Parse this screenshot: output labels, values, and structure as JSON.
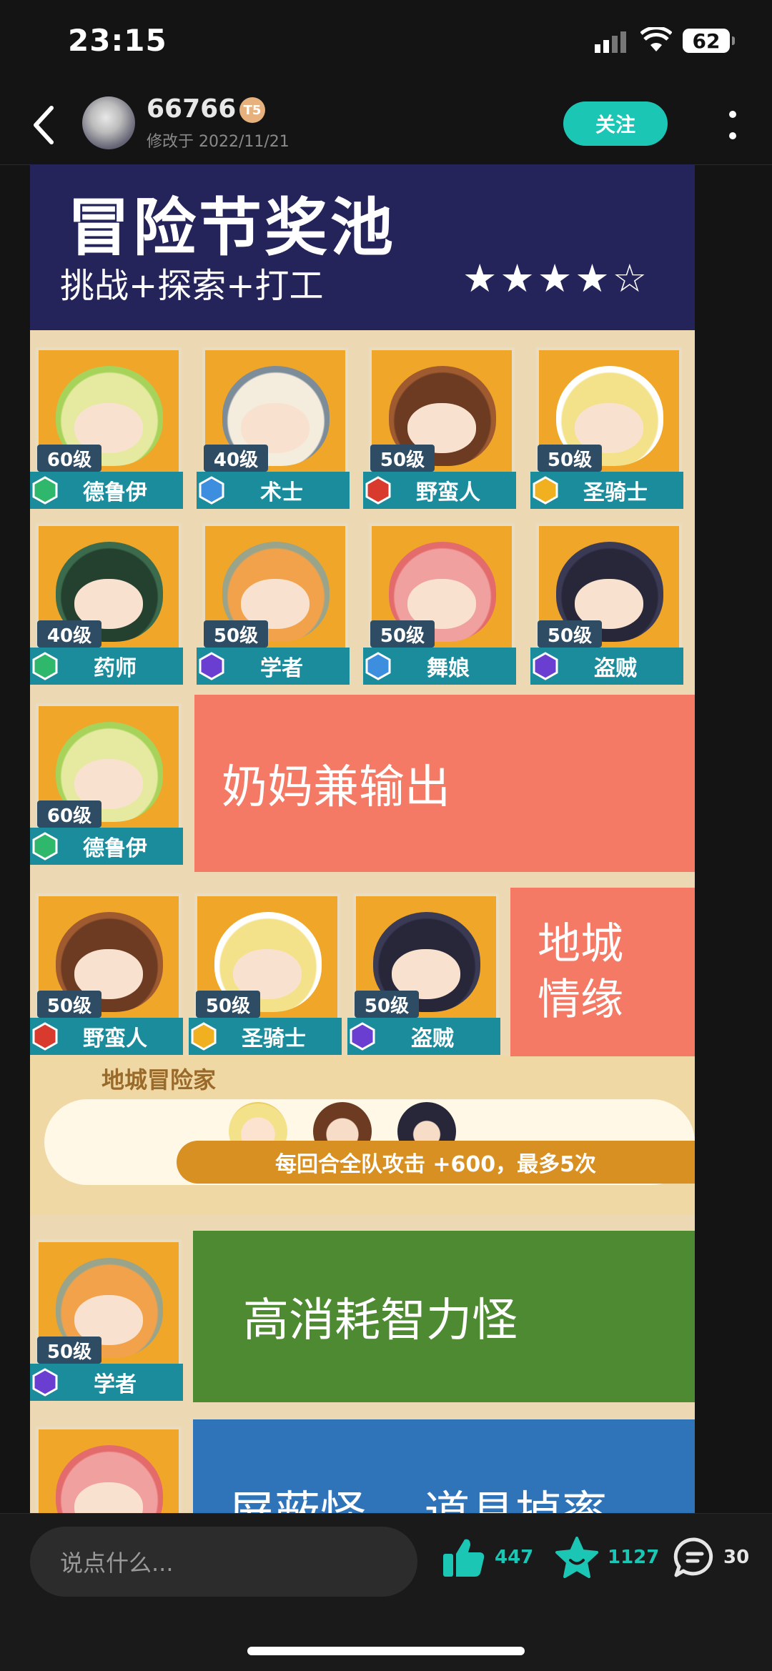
{
  "status": {
    "time": "23:15",
    "battery": "62"
  },
  "header": {
    "username": "66766",
    "level_badge": "T5",
    "modified": "修改于 2022/11/21",
    "follow_label": "关注"
  },
  "post": {
    "banner": {
      "title": "冒险节奖池",
      "subtitle": "挑战+探索+打工",
      "rating_stars": "★★★★☆"
    },
    "grid": [
      {
        "level": "60级",
        "name": "德鲁伊",
        "color": "#2fb86b"
      },
      {
        "level": "40级",
        "name": "术士",
        "color": "#3e8ee0"
      },
      {
        "level": "50级",
        "name": "野蛮人",
        "color": "#d83a2e"
      },
      {
        "level": "50级",
        "name": "圣骑士",
        "color": "#f0b020"
      },
      {
        "level": "40级",
        "name": "药师",
        "color": "#2fb86b"
      },
      {
        "level": "50级",
        "name": "学者",
        "color": "#6a3ed0"
      },
      {
        "level": "50级",
        "name": "舞娘",
        "color": "#3e8ee0"
      },
      {
        "level": "50级",
        "name": "盗贼",
        "color": "#6a3ed0"
      }
    ],
    "section1": {
      "card": {
        "level": "60级",
        "name": "德鲁伊"
      },
      "text": "奶妈兼输出"
    },
    "section2": {
      "cards": [
        {
          "level": "50级",
          "name": "野蛮人"
        },
        {
          "level": "50级",
          "name": "圣骑士"
        },
        {
          "level": "50级",
          "name": "盗贼"
        }
      ],
      "text": "地城\n情缘"
    },
    "adventurer": {
      "title": "地城冒险家",
      "effect": "每回合全队攻击 +600，最多5次"
    },
    "section3": {
      "card": {
        "level": "50级",
        "name": "学者"
      },
      "text": "高消耗智力怪"
    },
    "section4": {
      "text": "屏蔽怪    道具掉率"
    }
  },
  "bottom": {
    "input_placeholder": "说点什么...",
    "likes": "447",
    "stars": "1127",
    "comments": "30"
  },
  "colors": {
    "accent": "#1cc6b5",
    "banner": "#24245a",
    "salmon": "#f47a66",
    "green": "#4e8a32",
    "blue": "#2f74b8"
  }
}
